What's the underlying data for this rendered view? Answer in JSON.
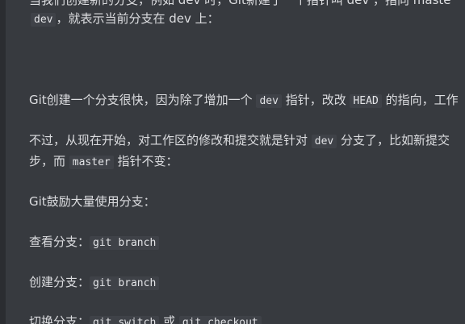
{
  "paragraphs": {
    "p0_cut": "当我们创建新的分支，例如 dev 时，Git新建了一个指针叫 dev ，指向 maste",
    "p0_l2": {
      "code": "dev",
      "text": "，就表示当前分支在 dev 上："
    },
    "p1": {
      "t1": "Git创建一个分支很快，因为除了增加一个 ",
      "c1": "dev",
      "t2": " 指针，改改 ",
      "c2": "HEAD",
      "t3": " 的指向，工作"
    },
    "p2_l1": {
      "t1": "不过，从现在开始，对工作区的修改和提交就是针对 ",
      "c1": "dev",
      "t2": " 分支了，比如新提交"
    },
    "p2_l2": {
      "t1": "步，而 ",
      "c1": "master",
      "t2": " 指针不变："
    },
    "p3": "Git鼓励大量使用分支：",
    "p4": {
      "label": "查看分支：",
      "code": "git branch"
    },
    "p5": {
      "label": "创建分支：",
      "code": "git branch"
    },
    "p6": {
      "label": "切换分支：",
      "c1": "git switch",
      "mid": " 或 ",
      "c2": "git checkout"
    }
  }
}
